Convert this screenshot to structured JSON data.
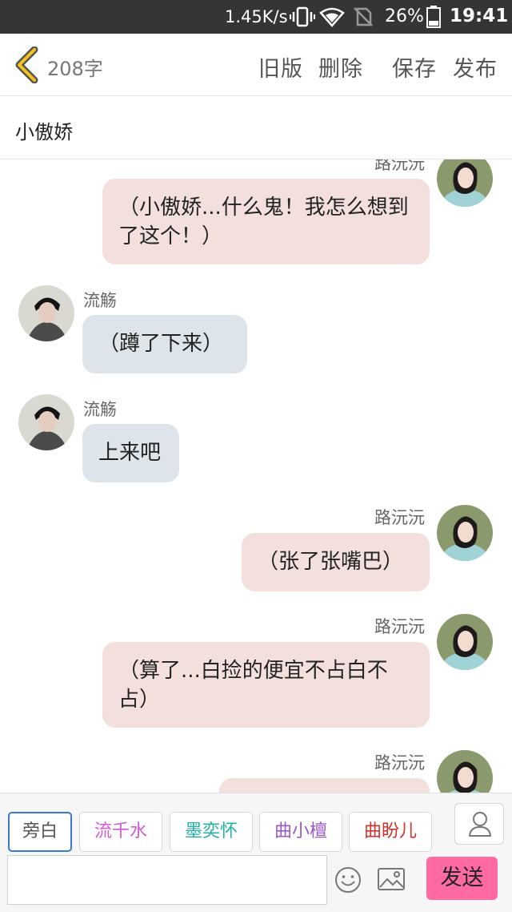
{
  "status_bar": {
    "speed": "1.45K/s",
    "battery": "26%",
    "time": "19:41",
    "icons": [
      "vibrate-icon",
      "wifi-icon",
      "no-sim-icon",
      "battery-icon"
    ]
  },
  "header": {
    "back_icon": "chevron-left-icon",
    "word_count": "208字",
    "actions": {
      "old": "旧版",
      "delete": "删除",
      "save": "保存",
      "publish": "发布"
    },
    "accent_color": "#f0c419"
  },
  "story": {
    "title": "小傲娇"
  },
  "messages": [
    {
      "speaker": "路沅沅",
      "side": "right",
      "text": "（小傲娇...什么鬼！我怎么想到了这个！）"
    },
    {
      "speaker": "流觞",
      "side": "left",
      "text": "（蹲了下来）"
    },
    {
      "speaker": "流觞",
      "side": "left",
      "text": "上来吧"
    },
    {
      "speaker": "路沅沅",
      "side": "right",
      "text": "（张了张嘴巴）"
    },
    {
      "speaker": "路沅沅",
      "side": "right",
      "text": "（算了...白捡的便宜不占白不占）"
    },
    {
      "speaker": "路沅沅",
      "side": "right",
      "text": ""
    }
  ],
  "roles": [
    {
      "label": "旁白",
      "color": "#555555",
      "active": true
    },
    {
      "label": "流千水",
      "color": "#d25ad6",
      "active": false
    },
    {
      "label": "墨奕怀",
      "color": "#22b1a2",
      "active": false
    },
    {
      "label": "曲小檀",
      "color": "#9b59c9",
      "active": false
    },
    {
      "label": "曲盼儿",
      "color": "#d2342c",
      "active": false
    }
  ],
  "input": {
    "placeholder": "",
    "send_label": "发送",
    "send_color": "#ff6aa3"
  }
}
